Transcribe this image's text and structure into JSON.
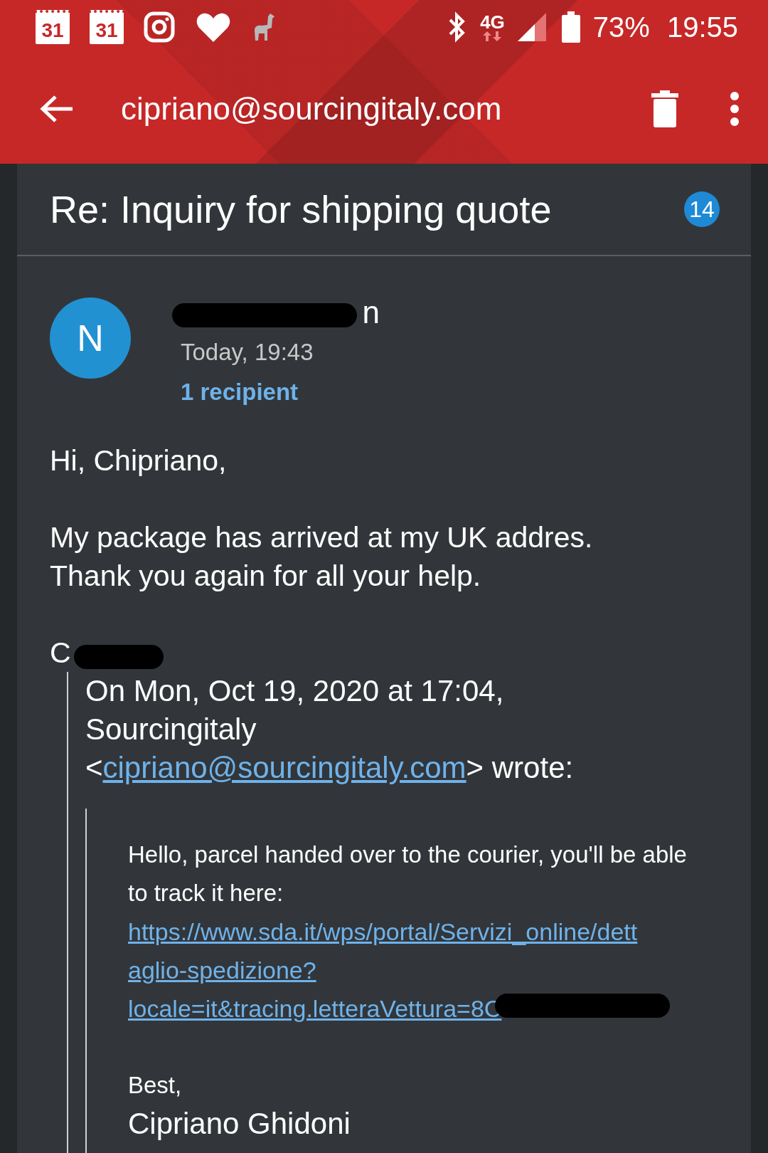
{
  "status_bar": {
    "notifications": [
      {
        "kind": "calendar",
        "text": "31"
      },
      {
        "kind": "calendar",
        "text": "31"
      },
      {
        "kind": "instagram"
      },
      {
        "kind": "heart"
      },
      {
        "kind": "llama"
      }
    ],
    "network": "4G",
    "battery": "73%",
    "time": "19:55"
  },
  "app_bar": {
    "title": "cipriano@sourcingitaly.com"
  },
  "subject": {
    "text": "Re: Inquiry for shipping quote",
    "count": "14"
  },
  "sender": {
    "initial": "N",
    "name_visible": "n",
    "date": "Today, 19:43",
    "recipients": "1 recipient"
  },
  "body": {
    "greeting": "Hi, Chipriano,",
    "paragraph": [
      "My package has arrived at my UK addres.",
      "Thank you again for all your help."
    ],
    "signature_visible": "C",
    "quote": {
      "header": [
        "On Mon, Oct 19, 2020 at 17:04,",
        "Sourcingitaly"
      ],
      "header_prefix": "<",
      "header_link": "cipriano@sourcingitaly.com",
      "header_suffix": "> wrote:",
      "inner": {
        "text": "Hello, parcel handed over to the courier, you'll be able to track it here:",
        "link_lines": [
          "https://www.sda.it/wps/portal/Servizi_online/dett",
          "aglio-spedizione?",
          "locale=it&tracing.letteraVettura=8C"
        ],
        "closing": "Best,",
        "name": "Cipriano Ghidoni"
      }
    }
  }
}
